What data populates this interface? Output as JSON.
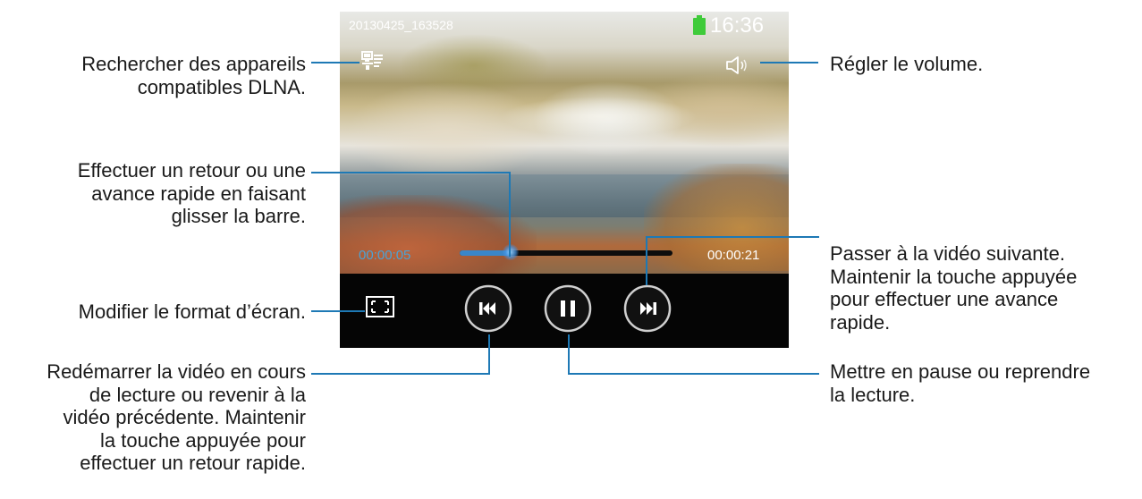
{
  "status_bar": {
    "file_name": "20130425_163528",
    "clock": "16:36",
    "battery_color": "#3fcb3a"
  },
  "player": {
    "elapsed": "00:00:05",
    "total": "00:00:21",
    "progress_fraction": 0.24,
    "accent_color": "#4aa3d6"
  },
  "icons": {
    "dlna": "dlna-devices-icon",
    "volume": "volume-icon",
    "aspect": "screen-ratio-icon",
    "prev": "skip-previous-icon",
    "pause": "pause-icon",
    "next": "skip-next-icon"
  },
  "annotations": {
    "dlna": [
      "Rechercher des appareils",
      "compatibles DLNA."
    ],
    "seek": [
      "Effectuer un retour ou une",
      "avance rapide en faisant",
      "glisser la barre."
    ],
    "aspect": [
      "Modifier le format d’écran."
    ],
    "prev": [
      "Redémarrer la vidéo en cours",
      "de lecture ou revenir à la",
      "vidéo précédente. Maintenir",
      "la touche appuyée pour",
      "effectuer un retour rapide."
    ],
    "volume": [
      "Régler le volume."
    ],
    "next": [
      "Passer à la vidéo suivante.",
      "Maintenir la touche appuyée",
      "pour effectuer une avance",
      "rapide."
    ],
    "pause": [
      "Mettre en pause ou reprendre",
      "la lecture."
    ]
  },
  "line_color": "#1e79b5"
}
